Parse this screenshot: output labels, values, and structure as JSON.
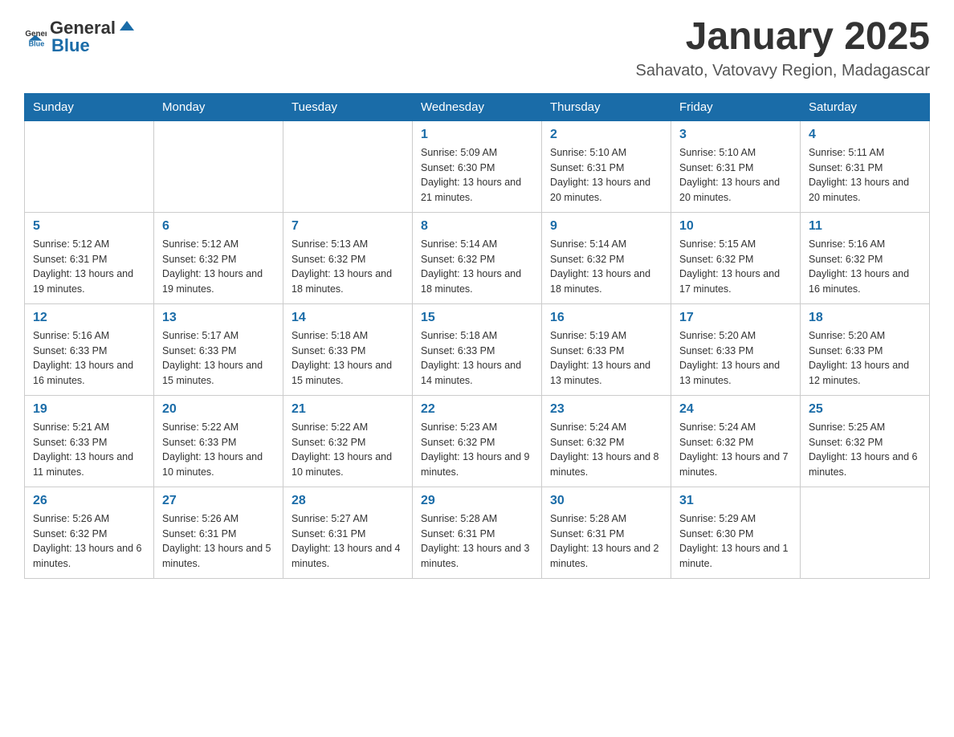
{
  "header": {
    "logo_general": "General",
    "logo_blue": "Blue",
    "month_title": "January 2025",
    "location": "Sahavato, Vatovavy Region, Madagascar"
  },
  "days_of_week": [
    "Sunday",
    "Monday",
    "Tuesday",
    "Wednesday",
    "Thursday",
    "Friday",
    "Saturday"
  ],
  "weeks": [
    [
      {
        "day": "",
        "info": ""
      },
      {
        "day": "",
        "info": ""
      },
      {
        "day": "",
        "info": ""
      },
      {
        "day": "1",
        "info": "Sunrise: 5:09 AM\nSunset: 6:30 PM\nDaylight: 13 hours and 21 minutes."
      },
      {
        "day": "2",
        "info": "Sunrise: 5:10 AM\nSunset: 6:31 PM\nDaylight: 13 hours and 20 minutes."
      },
      {
        "day": "3",
        "info": "Sunrise: 5:10 AM\nSunset: 6:31 PM\nDaylight: 13 hours and 20 minutes."
      },
      {
        "day": "4",
        "info": "Sunrise: 5:11 AM\nSunset: 6:31 PM\nDaylight: 13 hours and 20 minutes."
      }
    ],
    [
      {
        "day": "5",
        "info": "Sunrise: 5:12 AM\nSunset: 6:31 PM\nDaylight: 13 hours and 19 minutes."
      },
      {
        "day": "6",
        "info": "Sunrise: 5:12 AM\nSunset: 6:32 PM\nDaylight: 13 hours and 19 minutes."
      },
      {
        "day": "7",
        "info": "Sunrise: 5:13 AM\nSunset: 6:32 PM\nDaylight: 13 hours and 18 minutes."
      },
      {
        "day": "8",
        "info": "Sunrise: 5:14 AM\nSunset: 6:32 PM\nDaylight: 13 hours and 18 minutes."
      },
      {
        "day": "9",
        "info": "Sunrise: 5:14 AM\nSunset: 6:32 PM\nDaylight: 13 hours and 18 minutes."
      },
      {
        "day": "10",
        "info": "Sunrise: 5:15 AM\nSunset: 6:32 PM\nDaylight: 13 hours and 17 minutes."
      },
      {
        "day": "11",
        "info": "Sunrise: 5:16 AM\nSunset: 6:32 PM\nDaylight: 13 hours and 16 minutes."
      }
    ],
    [
      {
        "day": "12",
        "info": "Sunrise: 5:16 AM\nSunset: 6:33 PM\nDaylight: 13 hours and 16 minutes."
      },
      {
        "day": "13",
        "info": "Sunrise: 5:17 AM\nSunset: 6:33 PM\nDaylight: 13 hours and 15 minutes."
      },
      {
        "day": "14",
        "info": "Sunrise: 5:18 AM\nSunset: 6:33 PM\nDaylight: 13 hours and 15 minutes."
      },
      {
        "day": "15",
        "info": "Sunrise: 5:18 AM\nSunset: 6:33 PM\nDaylight: 13 hours and 14 minutes."
      },
      {
        "day": "16",
        "info": "Sunrise: 5:19 AM\nSunset: 6:33 PM\nDaylight: 13 hours and 13 minutes."
      },
      {
        "day": "17",
        "info": "Sunrise: 5:20 AM\nSunset: 6:33 PM\nDaylight: 13 hours and 13 minutes."
      },
      {
        "day": "18",
        "info": "Sunrise: 5:20 AM\nSunset: 6:33 PM\nDaylight: 13 hours and 12 minutes."
      }
    ],
    [
      {
        "day": "19",
        "info": "Sunrise: 5:21 AM\nSunset: 6:33 PM\nDaylight: 13 hours and 11 minutes."
      },
      {
        "day": "20",
        "info": "Sunrise: 5:22 AM\nSunset: 6:33 PM\nDaylight: 13 hours and 10 minutes."
      },
      {
        "day": "21",
        "info": "Sunrise: 5:22 AM\nSunset: 6:32 PM\nDaylight: 13 hours and 10 minutes."
      },
      {
        "day": "22",
        "info": "Sunrise: 5:23 AM\nSunset: 6:32 PM\nDaylight: 13 hours and 9 minutes."
      },
      {
        "day": "23",
        "info": "Sunrise: 5:24 AM\nSunset: 6:32 PM\nDaylight: 13 hours and 8 minutes."
      },
      {
        "day": "24",
        "info": "Sunrise: 5:24 AM\nSunset: 6:32 PM\nDaylight: 13 hours and 7 minutes."
      },
      {
        "day": "25",
        "info": "Sunrise: 5:25 AM\nSunset: 6:32 PM\nDaylight: 13 hours and 6 minutes."
      }
    ],
    [
      {
        "day": "26",
        "info": "Sunrise: 5:26 AM\nSunset: 6:32 PM\nDaylight: 13 hours and 6 minutes."
      },
      {
        "day": "27",
        "info": "Sunrise: 5:26 AM\nSunset: 6:31 PM\nDaylight: 13 hours and 5 minutes."
      },
      {
        "day": "28",
        "info": "Sunrise: 5:27 AM\nSunset: 6:31 PM\nDaylight: 13 hours and 4 minutes."
      },
      {
        "day": "29",
        "info": "Sunrise: 5:28 AM\nSunset: 6:31 PM\nDaylight: 13 hours and 3 minutes."
      },
      {
        "day": "30",
        "info": "Sunrise: 5:28 AM\nSunset: 6:31 PM\nDaylight: 13 hours and 2 minutes."
      },
      {
        "day": "31",
        "info": "Sunrise: 5:29 AM\nSunset: 6:30 PM\nDaylight: 13 hours and 1 minute."
      },
      {
        "day": "",
        "info": ""
      }
    ]
  ]
}
